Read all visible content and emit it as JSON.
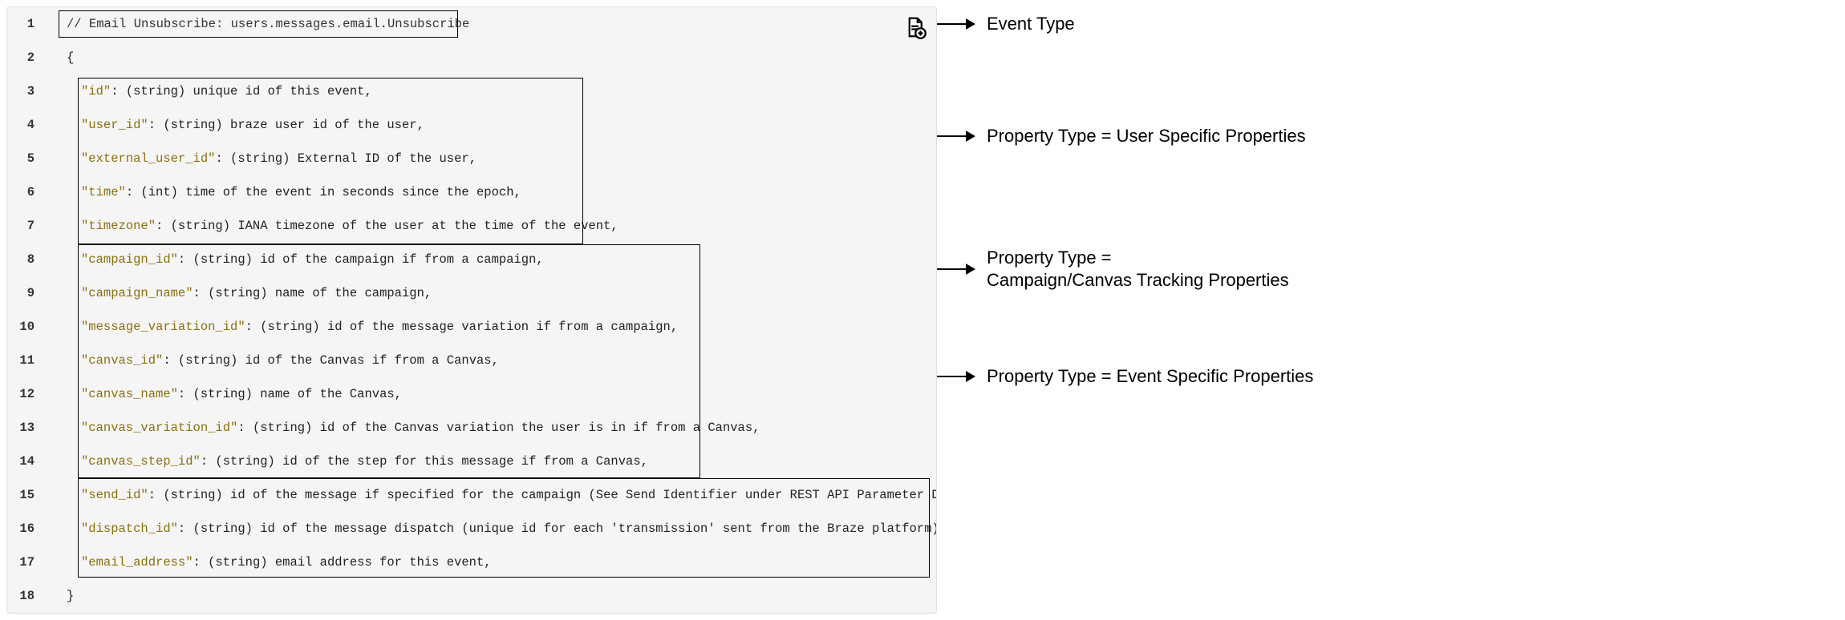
{
  "lines": [
    {
      "num": "1",
      "type": "comment",
      "text": "// Email Unsubscribe: users.messages.email.Unsubscribe"
    },
    {
      "num": "2",
      "type": "brace",
      "text": "{"
    },
    {
      "num": "3",
      "type": "prop",
      "key": "\"id\"",
      "rest": ": (string) unique id of this event,"
    },
    {
      "num": "4",
      "type": "prop",
      "key": "\"user_id\"",
      "rest": ": (string) braze user id of the user,"
    },
    {
      "num": "5",
      "type": "prop",
      "key": "\"external_user_id\"",
      "rest": ": (string) External ID of the user,"
    },
    {
      "num": "6",
      "type": "prop",
      "key": "\"time\"",
      "rest": ": (int) time of the event in seconds since the epoch,"
    },
    {
      "num": "7",
      "type": "prop",
      "key": "\"timezone\"",
      "rest": ": (string) IANA timezone of the user at the time of the event,"
    },
    {
      "num": "8",
      "type": "prop",
      "key": "\"campaign_id\"",
      "rest": ": (string) id of the campaign if from a campaign,"
    },
    {
      "num": "9",
      "type": "prop",
      "key": "\"campaign_name\"",
      "rest": ": (string) name of the campaign,"
    },
    {
      "num": "10",
      "type": "prop",
      "key": "\"message_variation_id\"",
      "rest": ": (string) id of the message variation if from a campaign,"
    },
    {
      "num": "11",
      "type": "prop",
      "key": "\"canvas_id\"",
      "rest": ": (string) id of the Canvas if from a Canvas,"
    },
    {
      "num": "12",
      "type": "prop",
      "key": "\"canvas_name\"",
      "rest": ": (string) name of the Canvas,"
    },
    {
      "num": "13",
      "type": "prop",
      "key": "\"canvas_variation_id\"",
      "rest": ": (string) id of the Canvas variation the user is in if from a Canvas,"
    },
    {
      "num": "14",
      "type": "prop",
      "key": "\"canvas_step_id\"",
      "rest": ": (string) id of the step for this message if from a Canvas,"
    },
    {
      "num": "15",
      "type": "prop",
      "key": "\"send_id\"",
      "rest": ": (string) id of the message if specified for the campaign (See Send Identifier under REST API Parameter Definition"
    },
    {
      "num": "16",
      "type": "prop",
      "key": "\"dispatch_id\"",
      "rest": ": (string) id of the message dispatch (unique id for each 'transmission' sent from the Braze platform). Users w"
    },
    {
      "num": "17",
      "type": "prop",
      "key": "\"email_address\"",
      "rest": ": (string) email address for this event,"
    },
    {
      "num": "18",
      "type": "brace",
      "text": "}"
    }
  ],
  "annotations": {
    "event_type": "Event Type",
    "user_props": "Property Type = User Specific Properties",
    "campaign_props_line1": "Property Type =",
    "campaign_props_line2": "Campaign/Canvas Tracking Properties",
    "event_props": "Property Type = Event Specific Properties"
  }
}
